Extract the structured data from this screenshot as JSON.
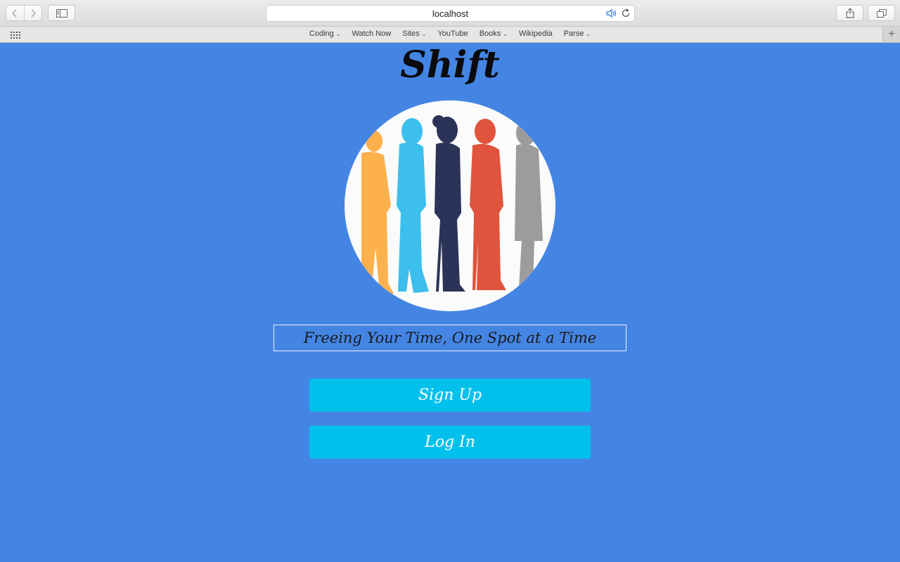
{
  "browser": {
    "url": "localhost",
    "bookmarks": [
      {
        "label": "Coding",
        "has_menu": true
      },
      {
        "label": "Watch Now",
        "has_menu": false
      },
      {
        "label": "Sites",
        "has_menu": true
      },
      {
        "label": "YouTube",
        "has_menu": false
      },
      {
        "label": "Books",
        "has_menu": true
      },
      {
        "label": "Wikipedia",
        "has_menu": false
      },
      {
        "label": "Parse",
        "has_menu": true
      }
    ],
    "icons": [
      "back-icon",
      "forward-icon",
      "sidebar-icon",
      "audio-icon",
      "reload-icon",
      "share-icon",
      "tabs-icon",
      "apps-grid-icon",
      "new-tab-icon"
    ]
  },
  "page": {
    "logo": "Shift",
    "tagline": "Freeing Your Time, One Spot at a Time",
    "signup_label": "Sign Up",
    "login_label": "Log In",
    "colors": {
      "background": "#4485e4",
      "button": "#02c0ec",
      "silhouettes": [
        "#fcb14d",
        "#3cbfec",
        "#2b3358",
        "#e0533c",
        "#9c9c9c"
      ]
    }
  }
}
